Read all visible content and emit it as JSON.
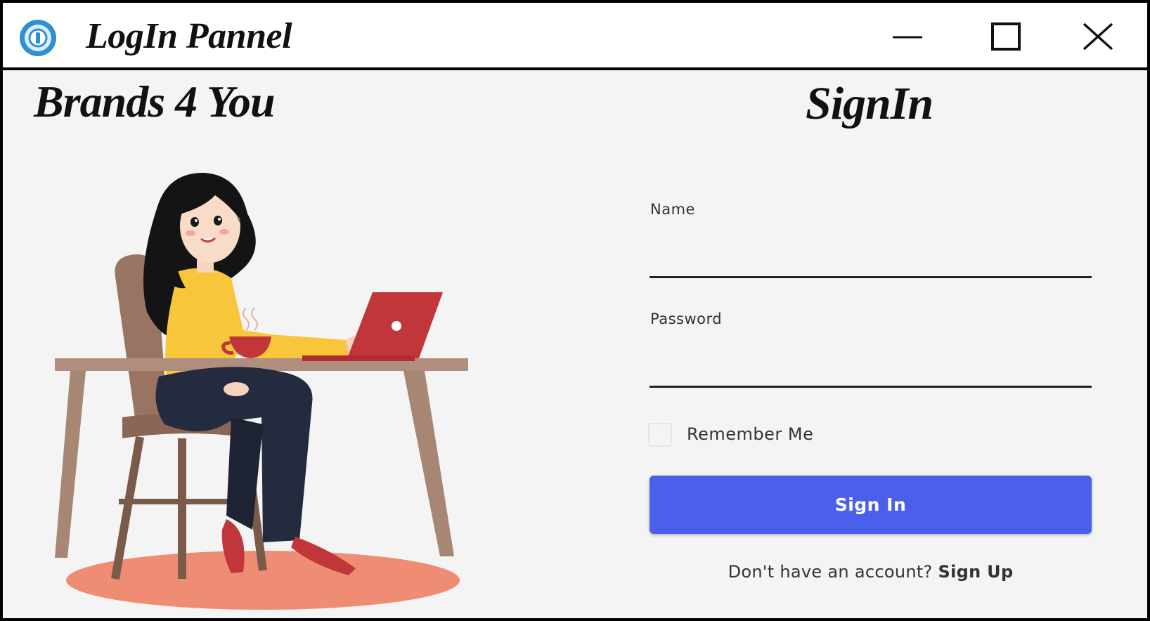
{
  "window": {
    "title": "LogIn Pannel",
    "icon": "app-logo-icon",
    "controls": {
      "minimize": "minimize-icon",
      "maximize": "maximize-icon",
      "close": "close-icon"
    }
  },
  "left_panel": {
    "brand": "Brands 4 You",
    "illustration": "woman-working-at-laptop-illustration"
  },
  "form": {
    "title": "SignIn",
    "name_label": "Name",
    "name_value": "",
    "password_label": "Password",
    "password_value": "",
    "remember_label": "Remember Me",
    "remember_checked": false,
    "submit_label": "Sign In",
    "signup_prompt": "Don't have an account?",
    "signup_link": "Sign Up"
  },
  "colors": {
    "accent": "#4a60ea",
    "background": "#f4f4f4",
    "text": "#333333",
    "laptop": "#c0363a",
    "sweater": "#f7c63b",
    "rug": "#ee8c74"
  }
}
